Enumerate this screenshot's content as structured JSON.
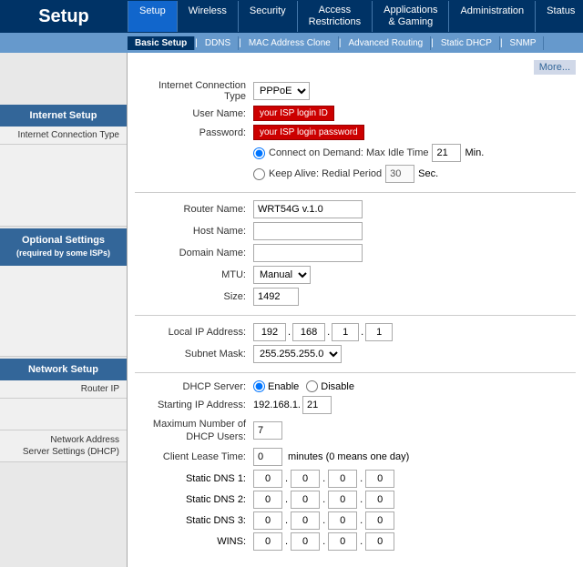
{
  "header": {
    "title": "Setup",
    "nav": [
      {
        "label": "Setup",
        "active": true
      },
      {
        "label": "Wireless"
      },
      {
        "label": "Security"
      },
      {
        "label": "Access\nRestrictions"
      },
      {
        "label": "Applications\n& Gaming"
      },
      {
        "label": "Administration"
      },
      {
        "label": "Status"
      }
    ],
    "subnav": [
      {
        "label": "Basic Setup",
        "active": true
      },
      {
        "label": "DDNS"
      },
      {
        "label": "MAC Address Clone"
      },
      {
        "label": "Advanced Routing"
      },
      {
        "label": "Static DHCP"
      },
      {
        "label": "SNMP"
      }
    ]
  },
  "sidebar": {
    "sections": [
      {
        "title": "Internet Setup",
        "items": [
          "Internet Connection Type"
        ]
      },
      {
        "title": "Optional Settings\n(required by some ISPs)",
        "items": []
      },
      {
        "title": "Network Setup",
        "items": [
          "Router IP",
          "Network Address\nServer Settings (DHCP)"
        ]
      }
    ]
  },
  "more_link": "More...",
  "internet": {
    "connection_type_label": "Internet Connection Type",
    "connection_type_value": "PPPoE",
    "user_name_label": "User Name:",
    "user_name_placeholder": "your ISP login ID",
    "password_label": "Password:",
    "password_placeholder": "your ISP login password",
    "connect_demand_label": "Connect on Demand: Max Idle Time",
    "connect_demand_value": "21",
    "connect_demand_unit": "Min.",
    "keep_alive_label": "Keep Alive: Redial Period",
    "keep_alive_value": "30",
    "keep_alive_unit": "Sec."
  },
  "optional": {
    "router_name_label": "Router Name:",
    "router_name_value": "WRT54G v.1.0",
    "host_name_label": "Host Name:",
    "host_name_value": "",
    "domain_name_label": "Domain Name:",
    "domain_name_value": "",
    "mtu_label": "MTU:",
    "mtu_value": "Manual",
    "size_label": "Size:",
    "size_value": "1492"
  },
  "network": {
    "router_ip": {
      "local_ip_label": "Local IP Address:",
      "ip1": "192",
      "ip2": "168",
      "ip3": "1",
      "ip4": "1",
      "subnet_label": "Subnet Mask:",
      "subnet_value": "255.255.255.0"
    },
    "dhcp": {
      "server_label": "DHCP Server:",
      "enable_label": "Enable",
      "disable_label": "Disable",
      "starting_ip_label": "Starting IP Address:",
      "starting_ip_base": "192.168.1.",
      "starting_ip_last": "21",
      "max_users_label": "Maximum Number of\nDHCP Users:",
      "max_users_value": "7",
      "lease_time_label": "Client Lease Time:",
      "lease_time_value": "0",
      "lease_time_note": "minutes (0 means one day)",
      "dns1_label": "Static DNS 1:",
      "dns2_label": "Static DNS 2:",
      "dns3_label": "Static DNS 3:",
      "wins_label": "WINS:",
      "dns_default": "0"
    }
  }
}
